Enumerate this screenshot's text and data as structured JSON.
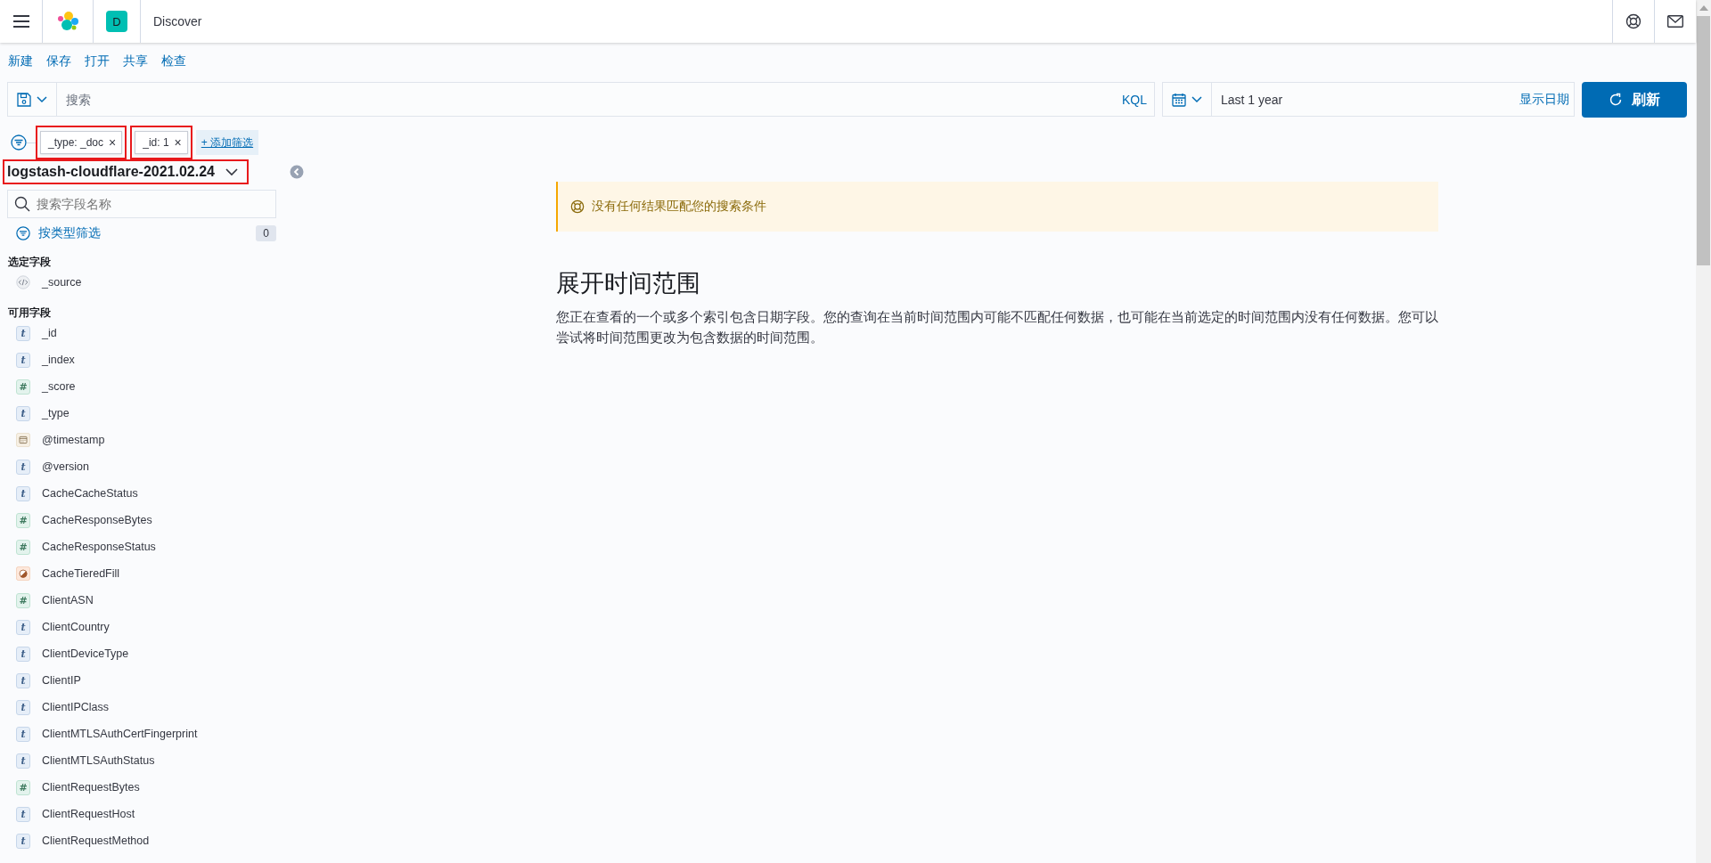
{
  "header": {
    "avatar": "D",
    "title": "Discover"
  },
  "top_menu": [
    "新建",
    "保存",
    "打开",
    "共享",
    "检查"
  ],
  "query_bar": {
    "placeholder": "搜索",
    "language": "KQL",
    "time_range": "Last 1 year",
    "show_dates": "显示日期",
    "refresh": "刷新"
  },
  "filters": [
    {
      "label": "_type: _doc",
      "close": "×",
      "highlighted": true
    },
    {
      "label": "_id: 1",
      "close": "×",
      "highlighted": true
    }
  ],
  "add_filter": "+ 添加筛选",
  "index_pattern": {
    "name": "logstash-cloudflare-2021.02.24",
    "highlighted": true
  },
  "sidebar": {
    "search_placeholder": "搜索字段名称",
    "filter_by_type": "按类型筛选",
    "filter_count": "0",
    "selected_heading": "选定字段",
    "selected_fields": [
      {
        "name": "_source",
        "kind": "source"
      }
    ],
    "available_heading": "可用字段",
    "available_fields": [
      {
        "name": "_id",
        "kind": "string",
        "glyph": "t"
      },
      {
        "name": "_index",
        "kind": "string",
        "glyph": "t"
      },
      {
        "name": "_score",
        "kind": "number",
        "glyph": "#"
      },
      {
        "name": "_type",
        "kind": "string",
        "glyph": "t"
      },
      {
        "name": "@timestamp",
        "kind": "date"
      },
      {
        "name": "@version",
        "kind": "string",
        "glyph": "t"
      },
      {
        "name": "CacheCacheStatus",
        "kind": "string",
        "glyph": "t"
      },
      {
        "name": "CacheResponseBytes",
        "kind": "number",
        "glyph": "#"
      },
      {
        "name": "CacheResponseStatus",
        "kind": "number",
        "glyph": "#"
      },
      {
        "name": "CacheTieredFill",
        "kind": "boolean"
      },
      {
        "name": "ClientASN",
        "kind": "number",
        "glyph": "#"
      },
      {
        "name": "ClientCountry",
        "kind": "string",
        "glyph": "t"
      },
      {
        "name": "ClientDeviceType",
        "kind": "string",
        "glyph": "t"
      },
      {
        "name": "ClientIP",
        "kind": "string",
        "glyph": "t"
      },
      {
        "name": "ClientIPClass",
        "kind": "string",
        "glyph": "t"
      },
      {
        "name": "ClientMTLSAuthCertFingerprint",
        "kind": "string",
        "glyph": "t"
      },
      {
        "name": "ClientMTLSAuthStatus",
        "kind": "string",
        "glyph": "t"
      },
      {
        "name": "ClientRequestBytes",
        "kind": "number",
        "glyph": "#"
      },
      {
        "name": "ClientRequestHost",
        "kind": "string",
        "glyph": "t"
      },
      {
        "name": "ClientRequestMethod",
        "kind": "string",
        "glyph": "t"
      }
    ]
  },
  "callout": "没有任何结果匹配您的搜索条件",
  "section": {
    "title": "展开时间范围",
    "text": "您正在查看的一个或多个索引包含日期字段。您的查询在当前时间范围内可能不匹配任何数据，也可能在当前选定的时间范围内没有任何数据。您可以尝试将时间范围更改为包含数据的时间范围。"
  }
}
